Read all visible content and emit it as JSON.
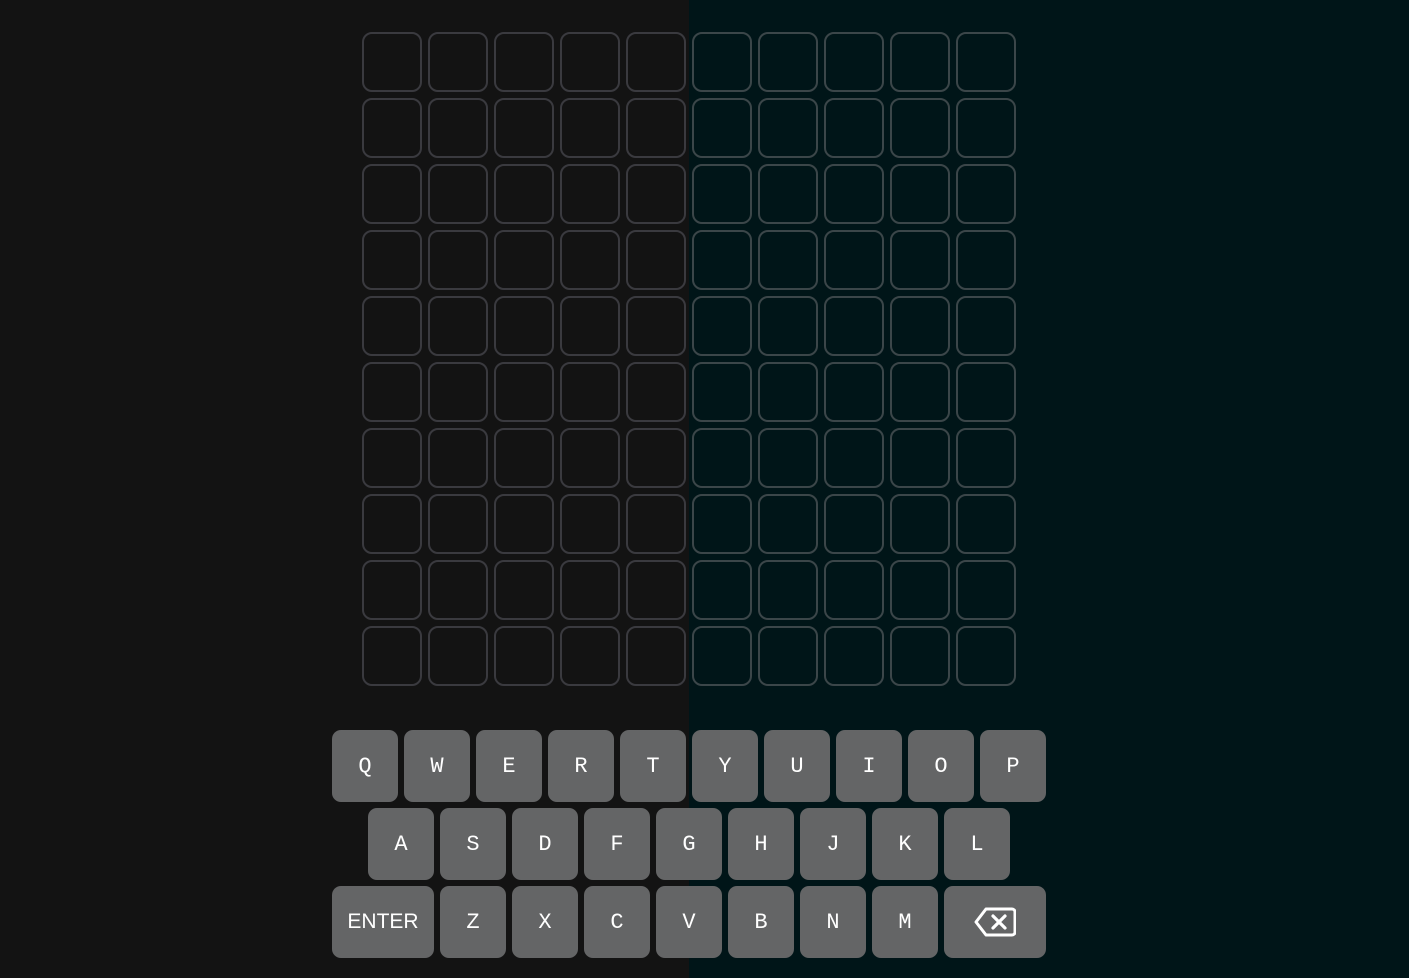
{
  "game": {
    "rows": 10,
    "columns": 10,
    "tiles": []
  },
  "keyboard": {
    "row1": [
      "Q",
      "W",
      "E",
      "R",
      "T",
      "Y",
      "U",
      "I",
      "O",
      "P"
    ],
    "row2": [
      "A",
      "S",
      "D",
      "F",
      "G",
      "H",
      "J",
      "K",
      "L"
    ],
    "row3": [
      "Z",
      "X",
      "C",
      "V",
      "B",
      "N",
      "M"
    ],
    "enter_label": "ENTER",
    "backspace_icon": "backspace-icon"
  },
  "colors": {
    "left_background": "#131313",
    "right_background": "#001518",
    "tile_border": "#3a3a3f",
    "key_background": "#646566",
    "key_text": "#ffffff"
  }
}
